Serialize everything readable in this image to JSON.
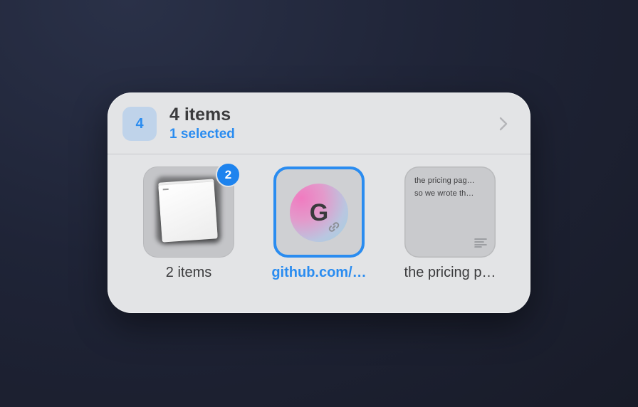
{
  "shelf": {
    "count_badge": "4",
    "title": "4 items",
    "subtitle": "1 selected",
    "items": [
      {
        "kind": "stack",
        "badge": "2",
        "caption": "2 items"
      },
      {
        "kind": "link",
        "favicon_letter": "G",
        "caption": "github.com/…"
      },
      {
        "kind": "note",
        "preview_lines": [
          "the pricing pag…",
          "so we wrote th…"
        ],
        "caption": "the pricing p…"
      }
    ]
  },
  "icons": {
    "chevron": "chevron-right-icon",
    "link": "link-icon",
    "text_lines": "text-lines-icon"
  },
  "colors": {
    "accent": "#2a8cf0",
    "badge_blue": "#1d83ee",
    "panel": "#e3e4e6"
  }
}
